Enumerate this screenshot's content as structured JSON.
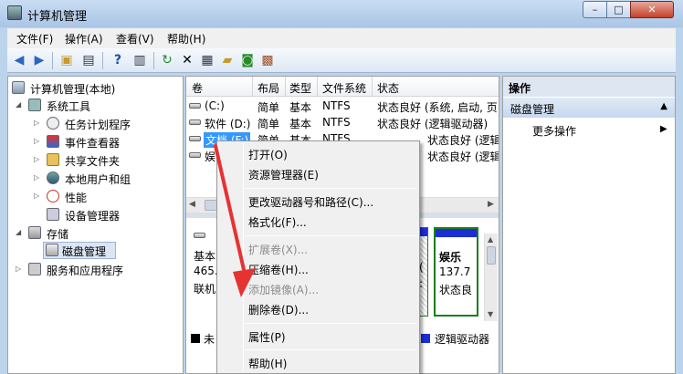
{
  "window": {
    "title": "计算机管理",
    "min": "–",
    "max": "□",
    "close": "✕"
  },
  "menu": [
    "文件(F)",
    "操作(A)",
    "查看(V)",
    "帮助(H)"
  ],
  "tree": {
    "root": "计算机管理(本地)",
    "system_tools": "系统工具",
    "task_scheduler": "任务计划程序",
    "event_viewer": "事件查看器",
    "shared_folders": "共享文件夹",
    "local_users": "本地用户和组",
    "performance": "性能",
    "device_manager": "设备管理器",
    "storage": "存储",
    "disk_management": "磁盘管理",
    "services": "服务和应用程序"
  },
  "volumes": {
    "headers": [
      "卷",
      "布局",
      "类型",
      "文件系统",
      "状态"
    ],
    "rows": [
      {
        "name": "(C:)",
        "layout": "简单",
        "type": "基本",
        "fs": "NTFS",
        "status": "状态良好 (系统, 启动, 页"
      },
      {
        "name": "软件 (D:)",
        "layout": "简单",
        "type": "基本",
        "fs": "NTFS",
        "status": "状态良好 (逻辑驱动器)"
      },
      {
        "name": "文档 (F:)",
        "layout": "简单",
        "type": "基本",
        "fs": "NTFS",
        "status": "状态良好 (逻辑驱动器)"
      },
      {
        "name": "娱",
        "layout": "",
        "type": "",
        "fs": "",
        "status": "状态良好 (逻辑驱动器)"
      }
    ]
  },
  "disk": {
    "line1": "基本",
    "line2": "465.",
    "line3": "联机",
    "p1_line2": "(",
    "p1_line3": ":",
    "p2_name": "娱乐",
    "p2_size": "137.7",
    "p2_status": "状态良",
    "legend_unallocated": "未",
    "legend_logical": "逻辑驱动器"
  },
  "context_menu": {
    "open": "打开(O)",
    "explorer": "资源管理器(E)",
    "change_letter": "更改驱动器号和路径(C)...",
    "format": "格式化(F)...",
    "extend": "扩展卷(X)...",
    "shrink": "压缩卷(H)...",
    "mirror": "添加镜像(A)...",
    "delete": "删除卷(D)...",
    "properties": "属性(P)",
    "help": "帮助(H)"
  },
  "actions": {
    "title": "操作",
    "section": "磁盘管理",
    "more": "更多操作"
  },
  "colors": {
    "accent_red": "#e53333",
    "selection": "#3399ff",
    "partition_blue": "#1b2ed6"
  }
}
